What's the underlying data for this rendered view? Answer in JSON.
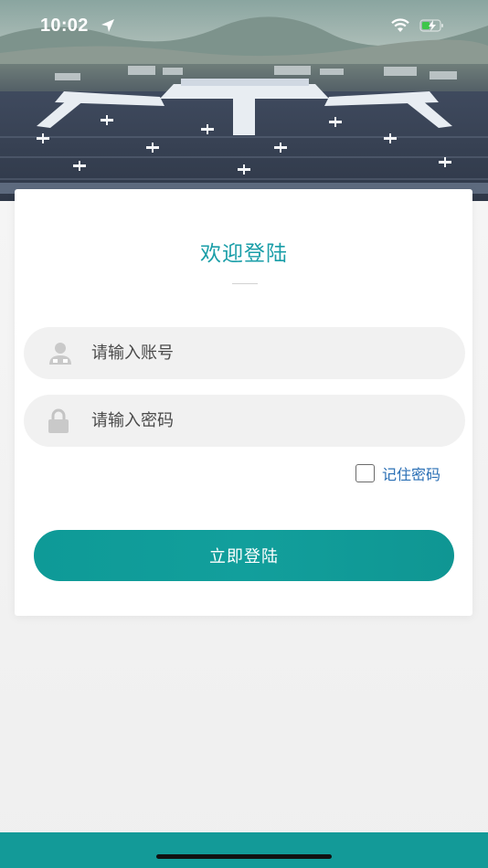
{
  "status_bar": {
    "time": "10:02"
  },
  "login": {
    "title": "欢迎登陆",
    "account_placeholder": "请输入账号",
    "password_placeholder": "请输入密码",
    "remember_label": "记住密码",
    "remember_checked": false,
    "submit_label": "立即登陆"
  },
  "colors": {
    "accent": "#129f9c",
    "title": "#1a9ea8",
    "link": "#2a6fb5"
  },
  "icons": {
    "status": [
      "location-arrow-icon",
      "wifi-icon",
      "battery-charging-icon"
    ],
    "fields": [
      "user-icon",
      "lock-icon"
    ]
  }
}
